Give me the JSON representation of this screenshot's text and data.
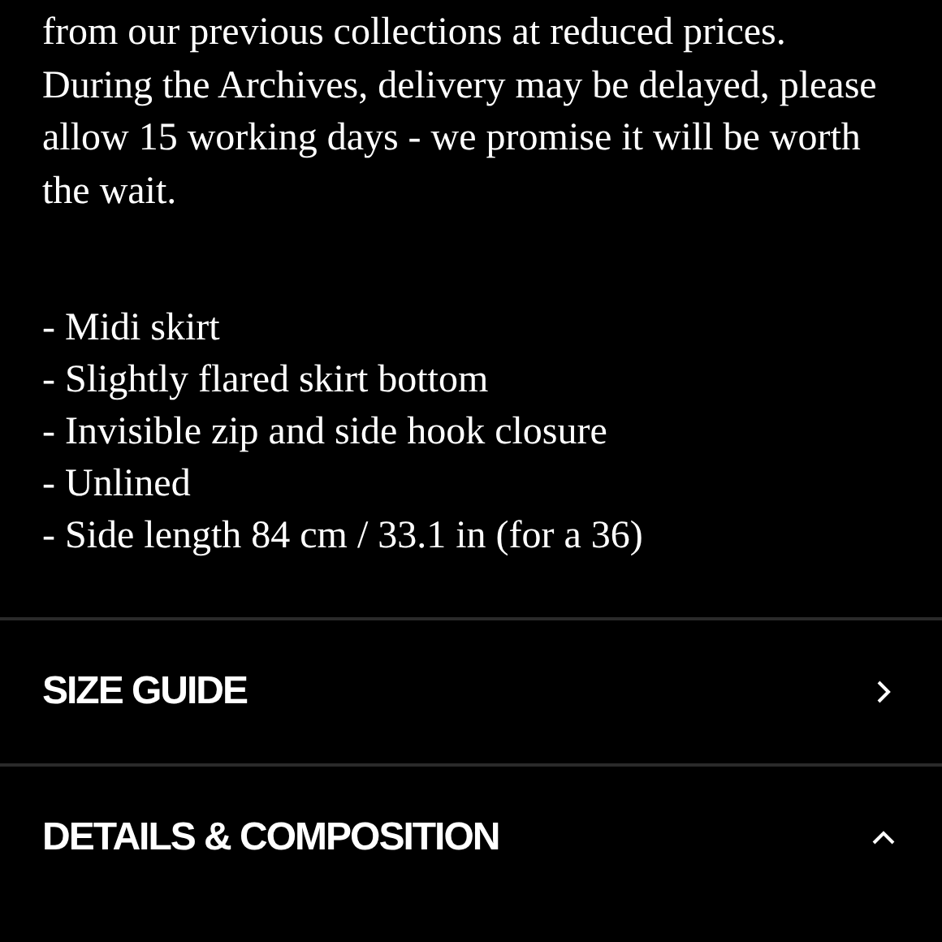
{
  "description": "from our previous collections at reduced prices. During the Archives, delivery may be delayed, please allow 15 working days - we promise it will be worth the wait.",
  "features": [
    "- Midi skirt",
    "- Slightly flared skirt bottom",
    "- Invisible zip and side hook closure",
    "- Unlined",
    "- Side length 84 cm / 33.1 in (for a 36)"
  ],
  "sections": [
    {
      "title": "SIZE GUIDE",
      "expanded": false
    },
    {
      "title": "DETAILS & COMPOSITION",
      "expanded": true
    }
  ]
}
